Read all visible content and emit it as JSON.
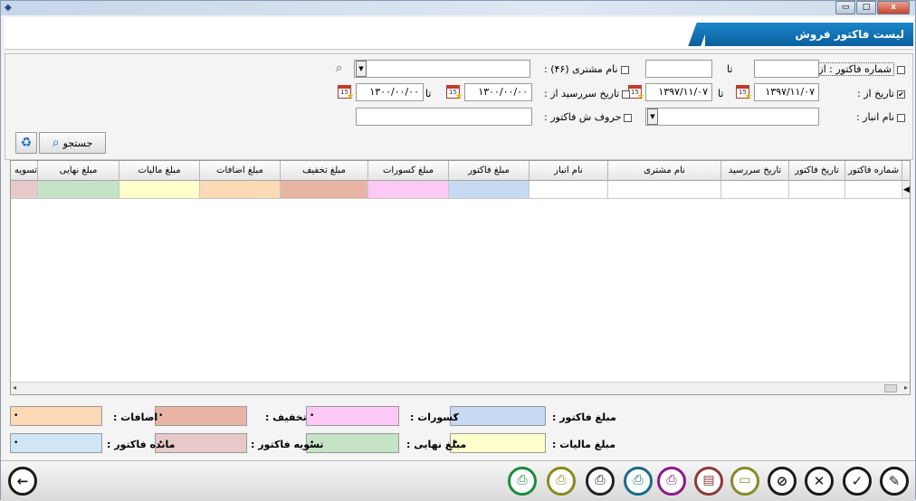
{
  "window": {
    "icon": "app-icon",
    "minimize": "▭",
    "maximize": "□",
    "close": "x"
  },
  "form_title": "لیست فاکتور فروش",
  "filters": {
    "invoice_no_label": "شماره فاکتور : از",
    "invoice_from": "",
    "to_label": "تا",
    "invoice_to": "",
    "customer_label": "نام مشتری (۴۶) :",
    "customer_value": "",
    "date_from_label": "تاریخ از :",
    "date_from": "۱۳۹۷/۱۱/۰۷",
    "date_to_label": "تا",
    "date_to": "۱۳۹۷/۱۱/۰۷",
    "due_from_label": "تاریخ سررسید از :",
    "due_from": "۱۳۰۰/۰۰/۰۰",
    "due_to_label": "تا",
    "due_to": "۱۳۰۰/۰۰/۰۰",
    "warehouse_label": "نام انبار :",
    "warehouse_value": "",
    "letters_label": "حروف ش فاکتور :",
    "letters_value": "",
    "date_checked": "✔",
    "calendar_day": "15"
  },
  "search_button": "جستجو",
  "grid": {
    "columns": [
      "شماره فاکتور",
      "تاریخ فاکتور",
      "تاریخ سررسید",
      "نام مشتری",
      "نام انبار",
      "مبلغ فاکتور",
      "مبلغ کسورات",
      "مبلغ تخفیف",
      "مبلغ اضافات",
      "مبلغ مالیات",
      "مبلغ نهایی",
      "تسویه ف"
    ],
    "row_colors": [
      "#ffffff",
      "#ffffff",
      "#ffffff",
      "#ffffff",
      "#ffffff",
      "#c6daf2",
      "#fcc8f4",
      "#e8b5a5",
      "#fdd9b5",
      "#ffffcc",
      "#c5e3c5",
      "#e7c9c9"
    ]
  },
  "totals": {
    "invoice_amount_label": "مبلغ فاکتور :",
    "deductions_label": "کسورات :",
    "discount_label": "تخفیف :",
    "additions_label": "اضافات :",
    "tax_label": "مبلغ مالیات :",
    "final_label": "مبلغ نهایی :",
    "settlement_label": "تسویه فاکتور :",
    "remaining_label": "مانده فاکتور :",
    "value": "•",
    "colors": {
      "invoice_amount": "#c6daf2",
      "deductions": "#fcc8f4",
      "discount": "#e8b5a5",
      "additions": "#fdd9b5",
      "tax": "#ffffcc",
      "final": "#c5e3c5",
      "settlement": "#e7c9c9",
      "remaining": "#cfe6f7"
    }
  },
  "toolbar": {
    "back": "←",
    "edit": "✎",
    "confirm": "✓",
    "cancel": "✕",
    "attach": "⊘",
    "print_colors": [
      "#1e8a3c",
      "#8a8a1a",
      "#222222",
      "#1a6a8a",
      "#8a1a8a",
      "#8a3a3a",
      "#8a8a2a"
    ]
  }
}
